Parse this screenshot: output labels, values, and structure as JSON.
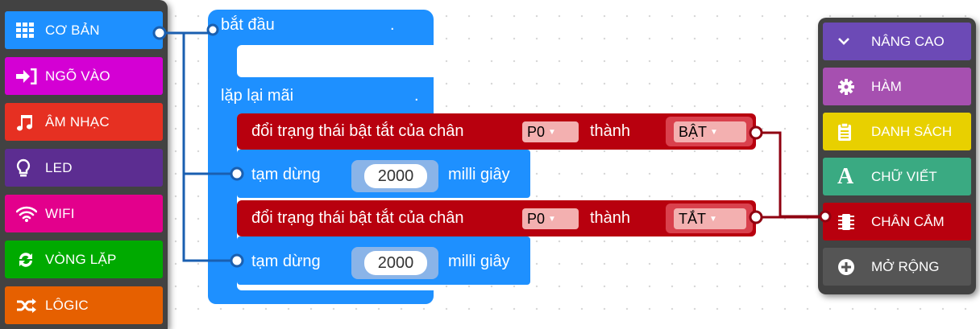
{
  "left_palette": {
    "items": [
      {
        "label": "CƠ BẢN",
        "icon": "grid-icon",
        "color": "#1E90FF"
      },
      {
        "label": "NGÕ VÀO",
        "icon": "input-arrow-icon",
        "color": "#D400D4"
      },
      {
        "label": "ÂM NHẠC",
        "icon": "music-note-icon",
        "color": "#E63022"
      },
      {
        "label": "LED",
        "icon": "lightbulb-icon",
        "color": "#5C2D91"
      },
      {
        "label": "WIFI",
        "icon": "wifi-icon",
        "color": "#E3008C"
      },
      {
        "label": "VÒNG LẶP",
        "icon": "loop-icon",
        "color": "#00AA00"
      },
      {
        "label": "LÔGIC",
        "icon": "shuffle-icon",
        "color": "#E66000"
      }
    ]
  },
  "right_palette": {
    "items": [
      {
        "label": "NÂNG CAO",
        "icon": "chevron-down-icon",
        "color": "#6C4AB6"
      },
      {
        "label": "HÀM",
        "icon": "gear-icon",
        "color": "#A650B0"
      },
      {
        "label": "DANH SÁCH",
        "icon": "clipboard-icon",
        "color": "#E8D000"
      },
      {
        "label": "CHỮ VIẾT",
        "icon": "letter-a-icon",
        "color": "#3AAA82"
      },
      {
        "label": "CHÂN CẮM",
        "icon": "chip-icon",
        "color": "#B8000E"
      },
      {
        "label": "MỞ RỘNG",
        "icon": "plus-circle-icon",
        "color": "#555555"
      }
    ]
  },
  "workspace": {
    "start_block": {
      "label": "bắt đầu",
      "dot": "."
    },
    "forever_block": {
      "label": "lặp lại mãi",
      "dot": "."
    },
    "toggle_on": {
      "prefix": "đổi trạng thái bật tắt của chân",
      "pin": "P0",
      "middle": "thành",
      "value": "BẬT"
    },
    "pause_1": {
      "label": "tạm dừng",
      "value": "2000",
      "unit": "milli giây"
    },
    "toggle_off": {
      "prefix": "đổi trạng thái bật tắt của chân",
      "pin": "P0",
      "middle": "thành",
      "value": "TẮT"
    },
    "pause_2": {
      "label": "tạm dừng",
      "value": "2000",
      "unit": "milli giây"
    }
  },
  "colors": {
    "basic_blue": "#1E90FF",
    "pins_red": "#B8000E",
    "palette_bg": "#424242"
  }
}
